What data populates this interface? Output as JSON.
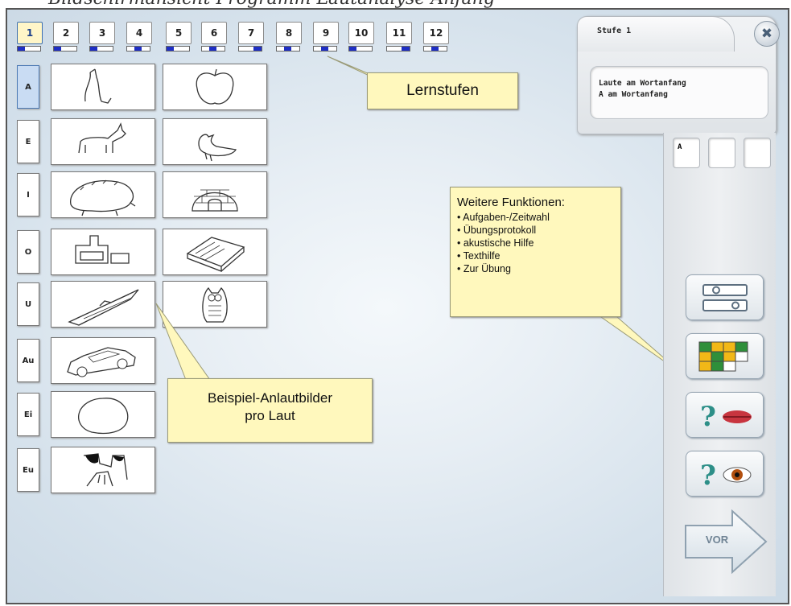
{
  "caption": "Bildschirmansicht Programm Lautanalyse Anfang",
  "levels": [
    {
      "label": "1",
      "fill": 0.33,
      "pos": 0,
      "active": true
    },
    {
      "label": "2",
      "fill": 0.33,
      "pos": 0
    },
    {
      "label": "3",
      "fill": 0.33,
      "pos": 0
    },
    {
      "label": "4",
      "fill": 0.33,
      "pos": 1
    },
    {
      "label": "5",
      "fill": 0.33,
      "pos": 0
    },
    {
      "label": "6",
      "fill": 0.33,
      "pos": 1
    },
    {
      "label": "7",
      "fill": 0.33,
      "pos": 2
    },
    {
      "label": "8",
      "fill": 0.33,
      "pos": 1
    },
    {
      "label": "9",
      "fill": 0.33,
      "pos": 1
    },
    {
      "label": "10",
      "fill": 0.33,
      "pos": 0
    },
    {
      "label": "11",
      "fill": 0.33,
      "pos": 2
    },
    {
      "label": "12",
      "fill": 0.33,
      "pos": 1
    }
  ],
  "sounds": [
    {
      "label": "A",
      "active": true,
      "pictures": [
        "arm",
        "apple"
      ]
    },
    {
      "label": "E",
      "pictures": [
        "donkey",
        "duck"
      ]
    },
    {
      "label": "I",
      "pictures": [
        "hedgehog",
        "igloo"
      ]
    },
    {
      "label": "O",
      "pictures": [
        "oven",
        "organizer"
      ]
    },
    {
      "label": "U",
      "pictures": [
        "submarine",
        "owl"
      ]
    },
    {
      "label": "Au",
      "pictures": [
        "car"
      ]
    },
    {
      "label": "Ei",
      "pictures": [
        "egg"
      ]
    },
    {
      "label": "Eu",
      "pictures": [
        "udder"
      ]
    }
  ],
  "callouts": {
    "levels": "Lernstufen",
    "examples_line1": "Beispiel-Anlautbilder",
    "examples_line2": "pro Laut",
    "functions_title": "Weitere Funktionen:",
    "functions": [
      "Aufgaben-/Zeitwahl",
      "Übungsprotokoll",
      "akustische Hilfe",
      "Texthilfe",
      "Zur Übung"
    ]
  },
  "panel": {
    "stage_tab": "Stufe 1",
    "close_icon": "close-icon",
    "description_line1": "Laute am Wortanfang",
    "description_line2": "A am Wortanfang",
    "answer_slots": [
      "A",
      "",
      ""
    ]
  },
  "tools": [
    "settings-sliders-icon",
    "protocol-grid-icon",
    "acoustic-help-icon",
    "text-help-icon"
  ],
  "next_label": "VOR",
  "colors": {
    "callout": "#fff8bd",
    "progress": "#1f2fc4",
    "grid_yellow": "#f2b817",
    "grid_green": "#2f8f3a",
    "help_red": "#c8353f",
    "eye_brown": "#b2500f"
  }
}
